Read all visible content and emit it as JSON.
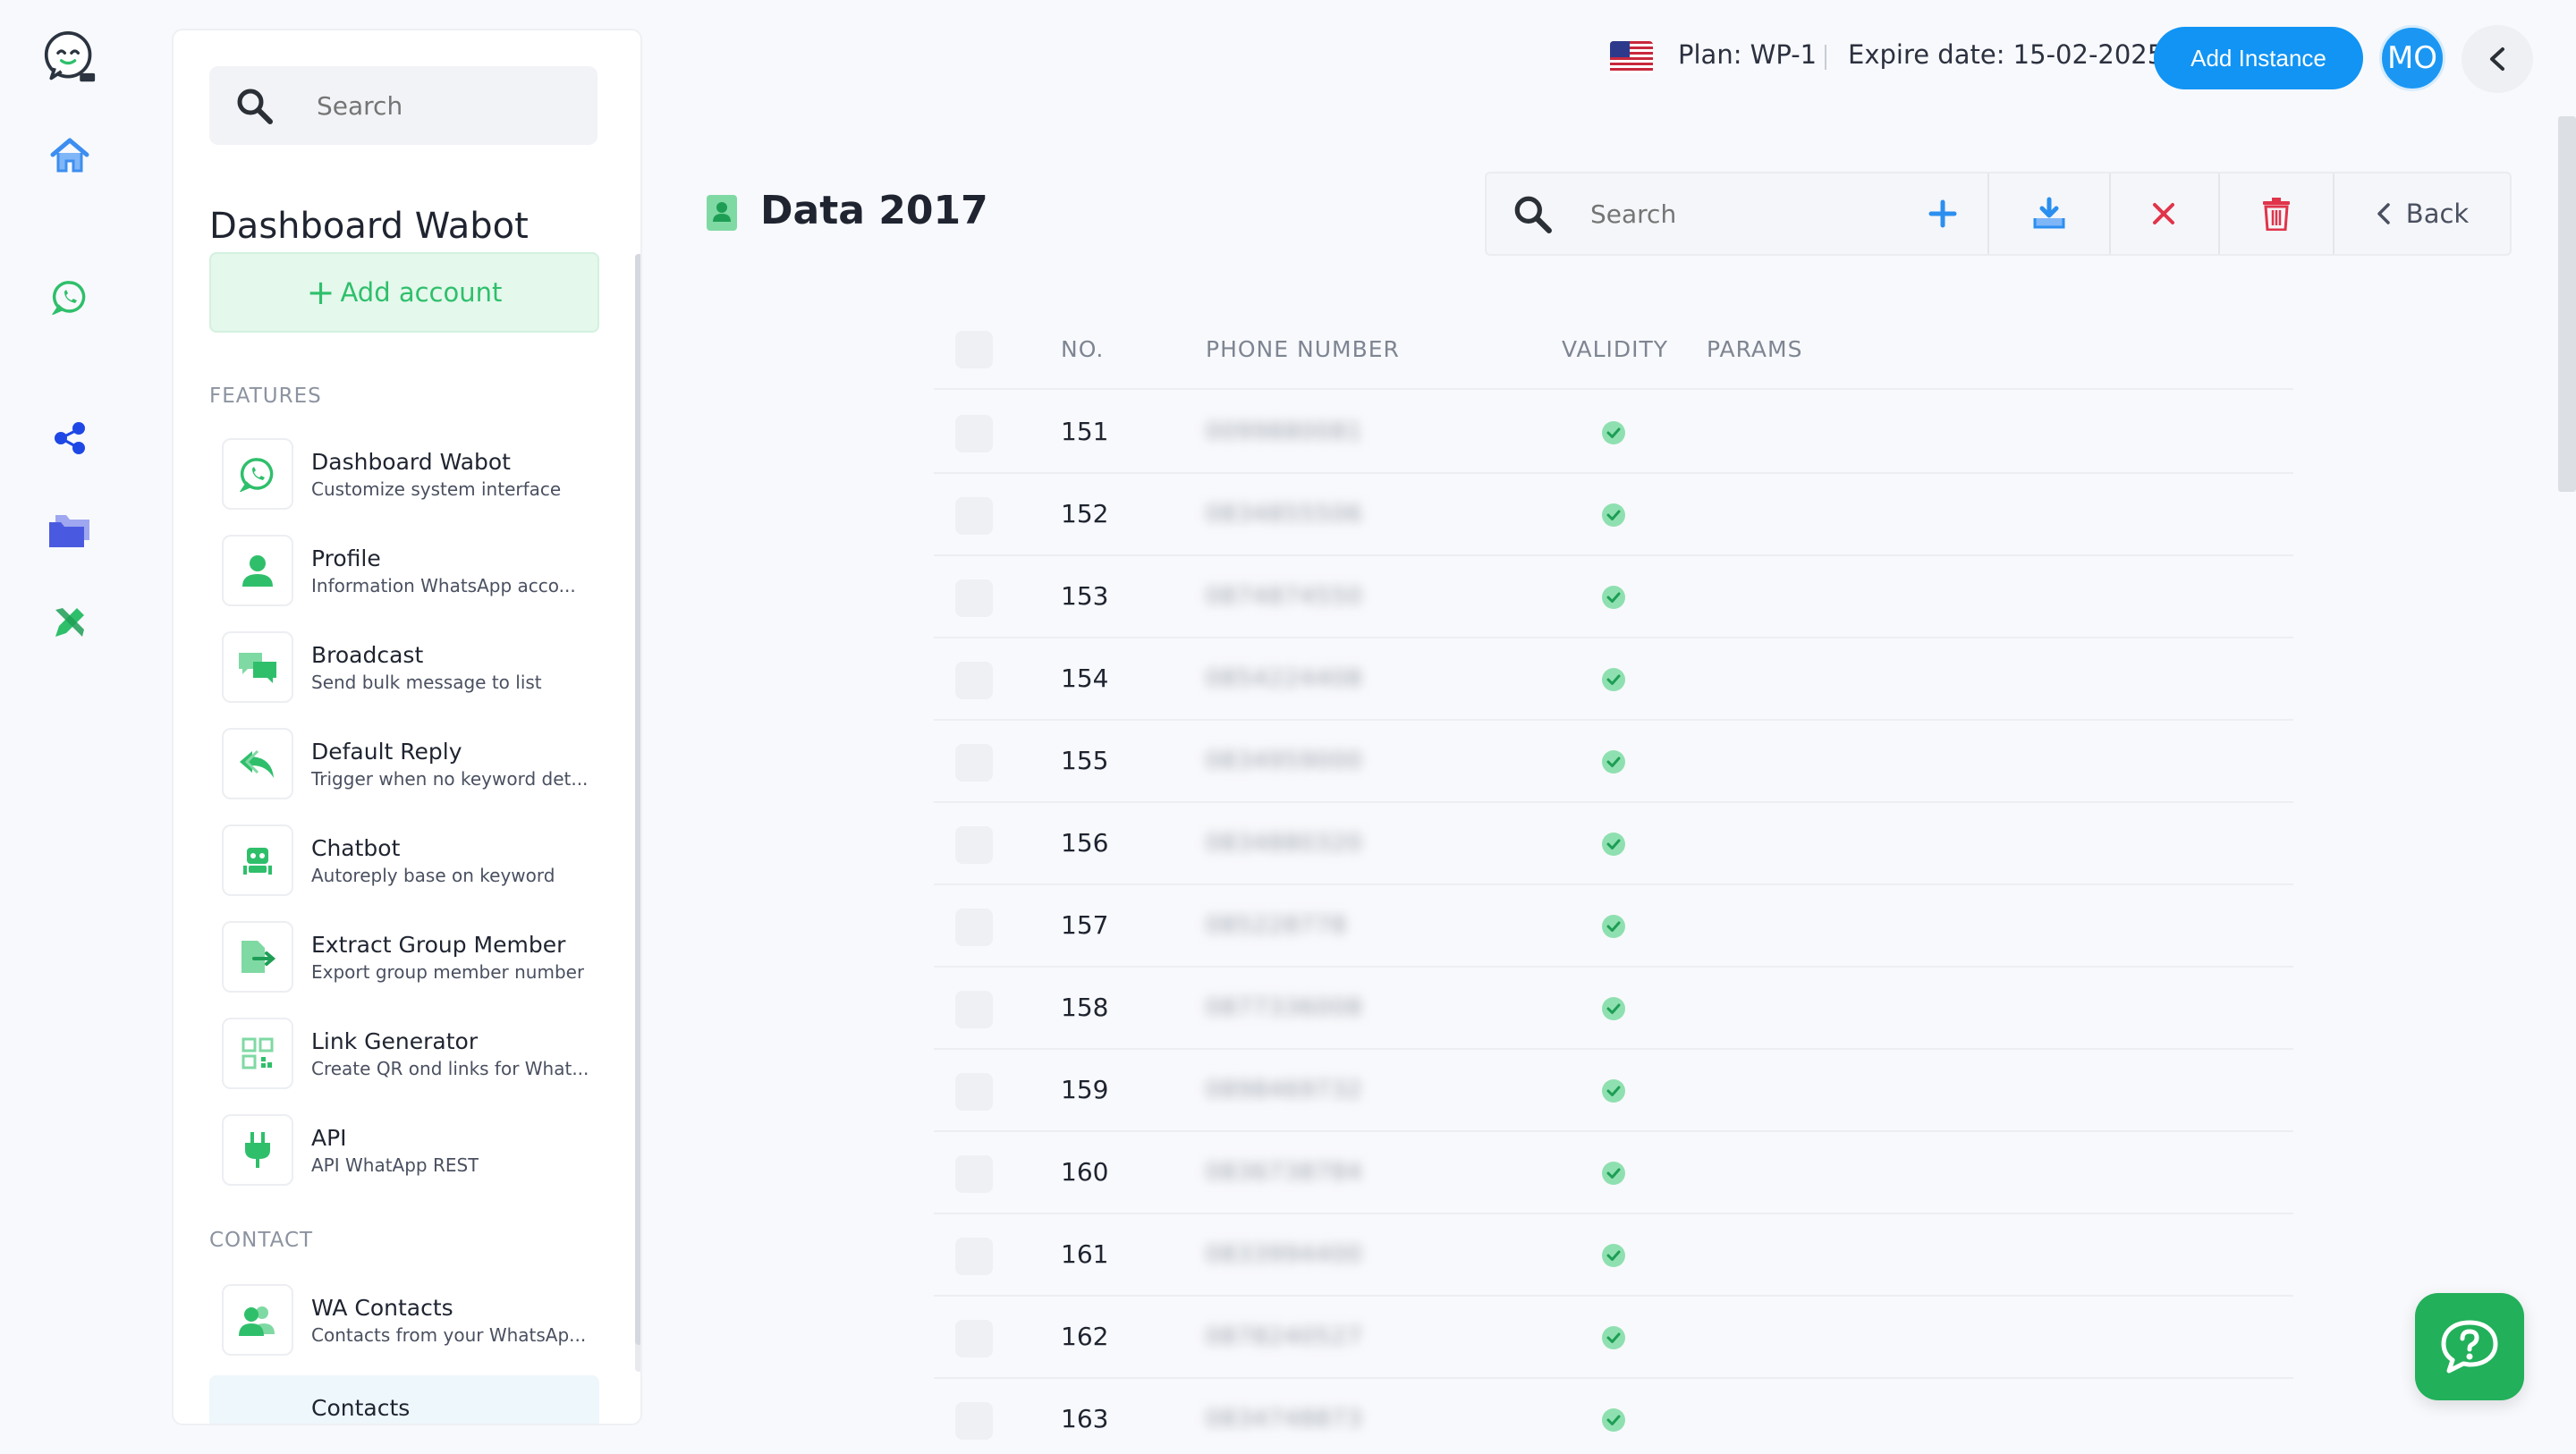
{
  "rail": {
    "items": [
      {
        "name": "logo",
        "icon": "bot-logo-icon"
      },
      {
        "name": "home",
        "icon": "home-icon"
      },
      {
        "name": "whatsapp",
        "icon": "whatsapp-icon"
      },
      {
        "name": "share",
        "icon": "share-nodes-icon"
      },
      {
        "name": "folders",
        "icon": "folders-icon"
      },
      {
        "name": "tools",
        "icon": "pencil-tools-icon"
      }
    ]
  },
  "sidebar": {
    "search_placeholder": "Search",
    "title": "Dashboard Wabot",
    "add_account": "Add account",
    "features_label": "FEATURES",
    "contact_label": "CONTACT",
    "features": [
      {
        "title": "Dashboard Wabot",
        "subtitle": "Customize system interface",
        "icon": "whatsapp-icon"
      },
      {
        "title": "Profile",
        "subtitle": "Information WhatsApp acco...",
        "icon": "user-icon"
      },
      {
        "title": "Broadcast",
        "subtitle": "Send bulk message to list",
        "icon": "chat-bubbles-icon"
      },
      {
        "title": "Default Reply",
        "subtitle": "Trigger when no keyword det...",
        "icon": "reply-icon"
      },
      {
        "title": "Chatbot",
        "subtitle": "Autoreply base on keyword",
        "icon": "robot-icon"
      },
      {
        "title": "Extract Group Member",
        "subtitle": "Export group member number",
        "icon": "file-export-icon"
      },
      {
        "title": "Link Generator",
        "subtitle": "Create QR ond links for What...",
        "icon": "qr-code-icon"
      },
      {
        "title": "API",
        "subtitle": "API WhatApp REST",
        "icon": "plug-icon"
      }
    ],
    "contacts": [
      {
        "title": "WA Contacts",
        "subtitle": "Contacts from your WhatsAp...",
        "icon": "users-icon"
      },
      {
        "title": "Contacts",
        "subtitle": "",
        "icon": "contacts-icon"
      }
    ]
  },
  "topbar": {
    "plan": "Plan: WP-1",
    "expire": "Expire date: 15-02-2025",
    "add_instance": "Add Instance",
    "avatar": "MO"
  },
  "page": {
    "title": "Data 2017"
  },
  "toolbar": {
    "search_placeholder": "Search",
    "back": "Back"
  },
  "table": {
    "headers": [
      "NO.",
      "PHONE NUMBER",
      "VALIDITY",
      "PARAMS"
    ],
    "rows": [
      {
        "no": "151",
        "phone": "0099880081",
        "valid": true
      },
      {
        "no": "152",
        "phone": "0834855506",
        "valid": true
      },
      {
        "no": "153",
        "phone": "0874874550",
        "valid": true
      },
      {
        "no": "154",
        "phone": "0854224408",
        "valid": true
      },
      {
        "no": "155",
        "phone": "0834959000",
        "valid": true
      },
      {
        "no": "156",
        "phone": "0834880320",
        "valid": true
      },
      {
        "no": "157",
        "phone": "085228778",
        "valid": true
      },
      {
        "no": "158",
        "phone": "0877336008",
        "valid": true
      },
      {
        "no": "159",
        "phone": "0898469732",
        "valid": true
      },
      {
        "no": "160",
        "phone": "0836738784",
        "valid": true
      },
      {
        "no": "161",
        "phone": "0833994400",
        "valid": true
      },
      {
        "no": "162",
        "phone": "0878240527",
        "valid": true
      },
      {
        "no": "163",
        "phone": "0834748873",
        "valid": true
      }
    ]
  },
  "colors": {
    "brand_green": "#22b05a",
    "primary_blue": "#1194f4",
    "danger_red": "#e0344a"
  }
}
